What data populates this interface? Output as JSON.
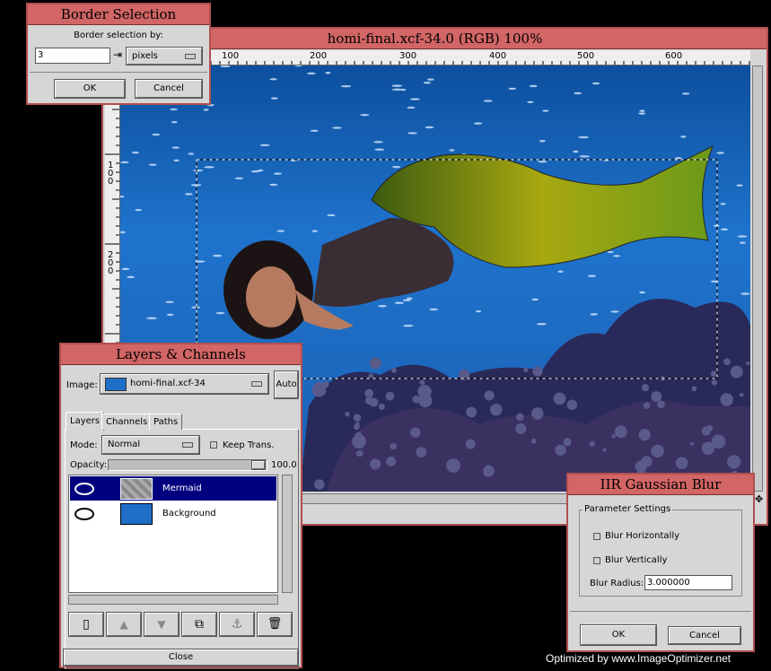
{
  "border_dialog": {
    "title": "Border Selection",
    "label": "Border selection by:",
    "value": "3",
    "unit": "pixels",
    "ok": "OK",
    "cancel": "Cancel"
  },
  "image_window": {
    "title": "homi-final.xcf-34.0 (RGB) 100%",
    "ruler_top": [
      "100",
      "200",
      "300",
      "400",
      "500",
      "600"
    ],
    "ruler_left": [
      "100",
      "200"
    ]
  },
  "layers_dialog": {
    "title": "Layers & Channels",
    "image_label": "Image:",
    "image_name": "homi-final.xcf-34",
    "auto": "Auto",
    "tabs": [
      "Layers",
      "Channels",
      "Paths"
    ],
    "mode_label": "Mode:",
    "mode_value": "Normal",
    "keep_trans": "Keep Trans.",
    "opacity_label": "Opacity:",
    "opacity_value": "100.0",
    "opacity_fraction": 1.0,
    "layers": [
      {
        "name": "Mermaid",
        "selected": true
      },
      {
        "name": "Background",
        "selected": false
      }
    ],
    "close": "Close"
  },
  "blur_dialog": {
    "title": "IIR Gaussian Blur",
    "group": "Parameter Settings",
    "horiz": "Blur Horizontally",
    "vert": "Blur Vertically",
    "radius_label": "Blur Radius:",
    "radius_value": "3.000000",
    "ok": "OK",
    "cancel": "Cancel"
  },
  "watermark": "Optimized by www.ImageOptimizer.net",
  "colors": {
    "title_bar": "#d26565",
    "window_bg": "#d6d6d6",
    "ocean": "#1f6fc8",
    "selection": "#00007f"
  }
}
